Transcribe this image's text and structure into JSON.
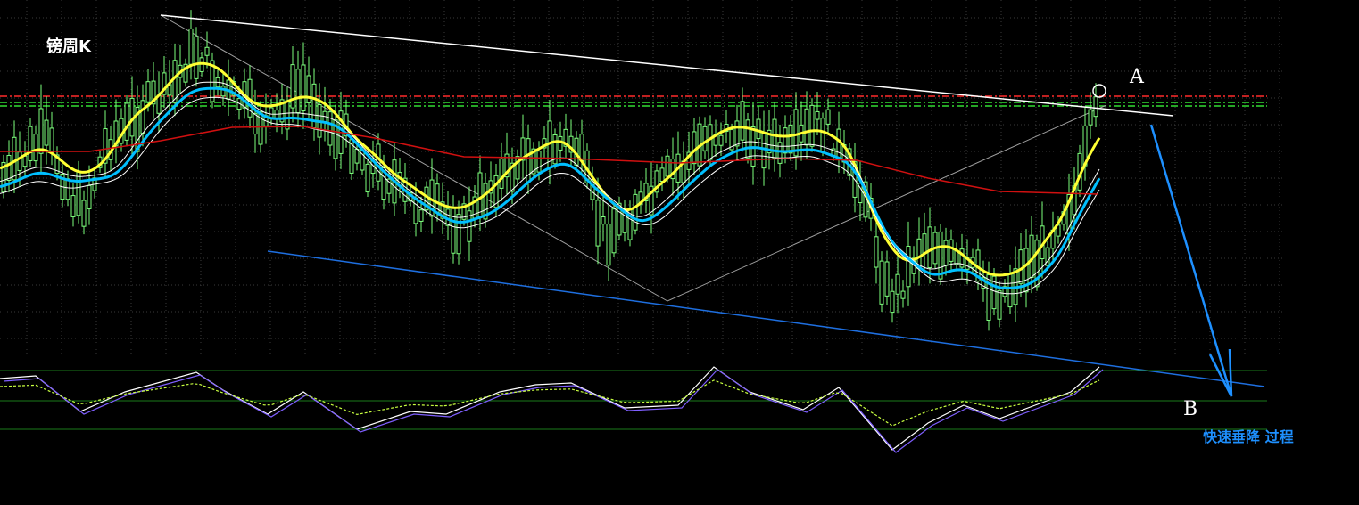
{
  "chart_data": {
    "type": "line",
    "title": "镑周K",
    "markers": {
      "a": "A",
      "b": "B"
    },
    "note": "快速垂降 过程",
    "grid": true,
    "background": "#000000",
    "colors": {
      "candle": "#7dff7d",
      "ma_fast": "#ffff33",
      "ma_mid": "#00bfff",
      "ma_ref": "#ffffff",
      "ma_long": "#d01010",
      "trend_upper": "#ffffff",
      "trend_lower": "#1e6fe0",
      "channel": "#a0a0a0",
      "projection": "#1e90ff",
      "level_red": "#ff2a2a",
      "level_green": "#33dd33",
      "note_text": "#1e90ff",
      "osc_main": "#ffffff",
      "osc_signal": "#c8ff40",
      "osc_alt": "#7f5fff",
      "osc_grid": "#1a7a1a"
    },
    "legend": "none"
  }
}
